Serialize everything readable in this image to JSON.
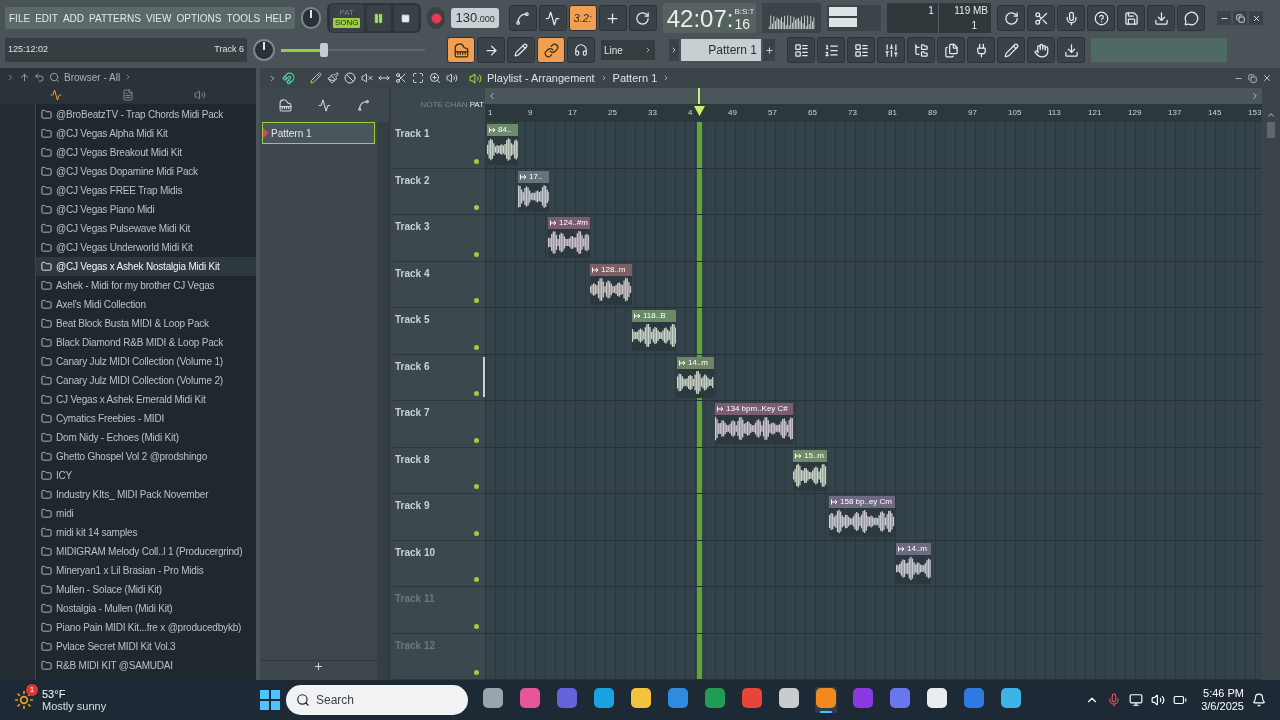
{
  "menu": [
    "FILE",
    "EDIT",
    "ADD",
    "PATTERNS",
    "VIEW",
    "OPTIONS",
    "TOOLS",
    "HELP"
  ],
  "transport": {
    "pat_label": "PAT",
    "song_label": "SONG",
    "song_mode": true,
    "playing": true
  },
  "tempo": {
    "whole": "130",
    "fraction": ".000"
  },
  "tool_toggles": [
    {
      "on": false
    },
    {
      "on": false
    },
    {
      "on": true,
      "label": "3.2:"
    },
    {
      "on": false
    },
    {
      "on": false
    }
  ],
  "time": {
    "main": "42:07:",
    "sub": "16",
    "unit": "B:S:T"
  },
  "memory": {
    "voices": "1",
    "ram": "119 MB",
    "cpu": "1"
  },
  "hint": {
    "position": "125:12:02",
    "target": "Track 6"
  },
  "master_volume": {
    "level": 0.3
  },
  "tool_buttons": [
    {
      "on": true
    },
    {
      "on": false
    },
    {
      "on": false
    },
    {
      "on": true
    },
    {
      "on": false
    }
  ],
  "snap": {
    "value": "Line"
  },
  "pattern_selector": {
    "value": "Pattern 1"
  },
  "browser": {
    "title": "Browser - All",
    "items": [
      {
        "name": "@BroBeatzTV - Trap Chords Midi Pack",
        "selected": false
      },
      {
        "name": "@CJ Vegas Alpha Midi Kit",
        "selected": false
      },
      {
        "name": "@CJ Vegas Breakout Midi Kit",
        "selected": false
      },
      {
        "name": "@CJ Vegas Dopamine Midi Pack",
        "selected": false
      },
      {
        "name": "@CJ Vegas FREE Trap Midis",
        "selected": false
      },
      {
        "name": "@CJ Vegas Piano Midi",
        "selected": false
      },
      {
        "name": "@CJ Vegas Pulsewave Midi Kit",
        "selected": false
      },
      {
        "name": "@CJ Vegas Underworld Midi Kit",
        "selected": false
      },
      {
        "name": "@CJ Vegas x Ashek Nostalgia Midi Kit",
        "selected": true
      },
      {
        "name": "Ashek - Midi for my brother CJ Vegas",
        "selected": false
      },
      {
        "name": "Axel's Midi Collection",
        "selected": false
      },
      {
        "name": "Beat Block Busta MIDI & Loop Pack",
        "selected": false
      },
      {
        "name": "Black Diamond R&B MIDI & Loop Pack",
        "selected": false
      },
      {
        "name": "Canary Julz MIDI Collection (Volume 1)",
        "selected": false
      },
      {
        "name": "Canary Julz MIDI Collection (Volume 2)",
        "selected": false
      },
      {
        "name": "CJ Vegas x Ashek Emerald Midi Kit",
        "selected": false
      },
      {
        "name": "Cymatics Freebies - MIDI",
        "selected": false
      },
      {
        "name": "Dom Nidy - Echoes (Midi Kit)",
        "selected": false
      },
      {
        "name": "Ghetto Ghospel Vol 2 @prodshingo",
        "selected": false
      },
      {
        "name": "ICY",
        "selected": false
      },
      {
        "name": "Industry KIts_ MIDI Pack November",
        "selected": false
      },
      {
        "name": "midi",
        "selected": false
      },
      {
        "name": "midi kit 14 samples",
        "selected": false
      },
      {
        "name": "MIDIGRAM Melody Coll..l 1 (Producergrind)",
        "selected": false
      },
      {
        "name": "Mineryan1 x Lil Brasian - Pro Midis",
        "selected": false
      },
      {
        "name": "Mullen - Solace (Midi Kit)",
        "selected": false
      },
      {
        "name": "Nostalgia - Mullen (Midi Kit)",
        "selected": false
      },
      {
        "name": "Piano Pain MIDI Kit...fre x @producedbykb)",
        "selected": false
      },
      {
        "name": "Pvlace Secret MIDI Kit Vol.3",
        "selected": false
      },
      {
        "name": "R&B MIDI KIT @SAMUDAI",
        "selected": false
      }
    ]
  },
  "playlist": {
    "title": "Playlist - Arrangement",
    "pattern": "Pattern 1",
    "patterns": [
      {
        "name": "Pattern 1",
        "selected": true
      }
    ],
    "column_labels": [
      {
        "label": "NOTE",
        "selected": false
      },
      {
        "label": "CHAN",
        "selected": false
      },
      {
        "label": "PAT",
        "selected": true
      }
    ],
    "ruler": [
      "1",
      "9",
      "17",
      "25",
      "33",
      "4",
      "49",
      "57",
      "65",
      "73",
      "81",
      "89",
      "97",
      "105",
      "113",
      "121",
      "129",
      "137",
      "145",
      "153"
    ],
    "tracks": [
      {
        "name": "Track 1",
        "empty": false,
        "selected": false,
        "clip": {
          "label": "84..",
          "color": "#6d8a6c"
        }
      },
      {
        "name": "Track 2",
        "empty": false,
        "selected": false,
        "clip": {
          "label": "17..",
          "color": "#66737b"
        }
      },
      {
        "name": "Track 3",
        "empty": false,
        "selected": false,
        "clip": {
          "label": "124..#m",
          "color": "#7b5c6f"
        }
      },
      {
        "name": "Track 4",
        "empty": false,
        "selected": false,
        "clip": {
          "label": "128..m",
          "color": "#7c5f63"
        }
      },
      {
        "name": "Track 5",
        "empty": false,
        "selected": false,
        "clip": {
          "label": "118..B",
          "color": "#6b8a66"
        }
      },
      {
        "name": "Track 6",
        "empty": false,
        "selected": true,
        "clip": {
          "label": "14..m",
          "color": "#6d8466"
        }
      },
      {
        "name": "Track 7",
        "empty": false,
        "selected": false,
        "clip": {
          "label": "134 bpm..Key  C#",
          "color": "#7a5e70"
        }
      },
      {
        "name": "Track 8",
        "empty": false,
        "selected": false,
        "clip": {
          "label": "15..m",
          "color": "#6f8c68"
        }
      },
      {
        "name": "Track 9",
        "empty": false,
        "selected": false,
        "clip": {
          "label": "158 bp..ey  Cm",
          "color": "#6f6a82"
        }
      },
      {
        "name": "Track 10",
        "empty": false,
        "selected": false,
        "clip": {
          "label": "14..m",
          "color": "#6c6b80"
        }
      },
      {
        "name": "Track 11",
        "empty": true,
        "selected": false
      },
      {
        "name": "Track 12",
        "empty": true,
        "selected": false
      }
    ]
  },
  "taskbar": {
    "weather": {
      "temperature": "53°F",
      "condition": "Mostly sunny",
      "badge": "1"
    },
    "search": {
      "placeholder": "Search"
    },
    "apps": [
      {
        "active": false
      },
      {
        "active": false
      },
      {
        "active": false
      },
      {
        "active": false
      },
      {
        "active": false
      },
      {
        "active": false
      },
      {
        "active": false
      },
      {
        "active": false
      },
      {
        "active": false
      },
      {
        "active": true
      },
      {
        "active": false
      },
      {
        "active": false
      },
      {
        "active": false
      },
      {
        "active": false
      },
      {
        "active": false
      }
    ],
    "time": "5:46 PM",
    "date": "3/6/2025"
  }
}
